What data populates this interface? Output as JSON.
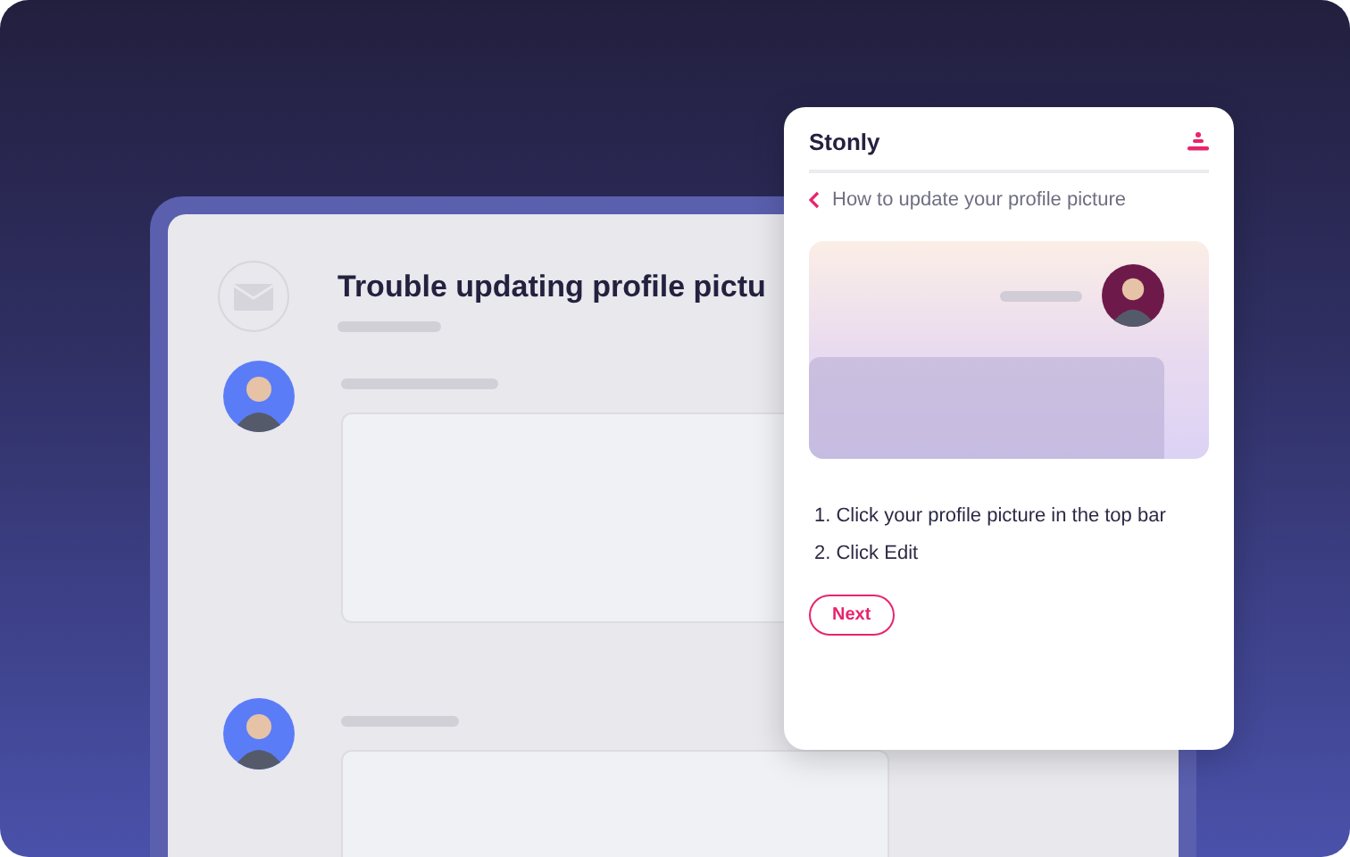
{
  "thread": {
    "title": "Trouble updating profile pictu"
  },
  "guide": {
    "brand": "Stonly",
    "back_title": "How to update your profile picture",
    "steps": [
      "1. Click your profile picture in the top bar",
      "2. Click Edit"
    ],
    "next_button": "Next"
  }
}
